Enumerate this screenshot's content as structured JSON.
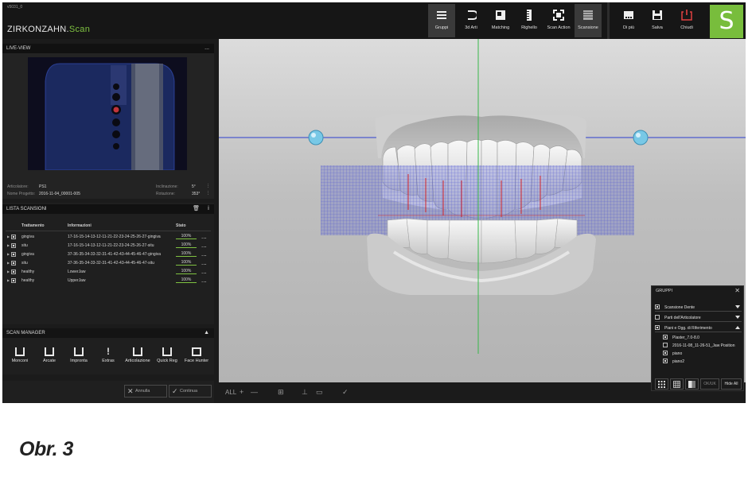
{
  "version": "v5031_0",
  "brand": {
    "name": "ZIRKONZAHN.",
    "suffix": "Scan"
  },
  "toolbar": {
    "gruppi": "Gruppi",
    "arti3d": "3d Arti",
    "matching": "Matching",
    "righello": "Righello",
    "scan_action": "Scan Action",
    "scansione": "Scansione",
    "di_piu": "Di più",
    "salva": "Salva",
    "chiudi": "Chiudi",
    "logo": "S"
  },
  "live_view": {
    "title": "LIVE-VIEW",
    "more": "...",
    "articolatore_label": "Articolatore:",
    "articolatore_value": "PS1",
    "nome_label": "Nome Progetto:",
    "nome_value": "2016-11-04_00001-005",
    "inclinazione_label": "Inclinazione:",
    "inclinazione_value": "5°",
    "rotazione_label": "Rotazione:",
    "rotazione_value": "353°"
  },
  "scan_list": {
    "title": "LISTA SCANSIONI",
    "headers": {
      "trattamento": "Trattamento",
      "informazioni": "Informazioni",
      "stato": "Stato"
    },
    "rows": [
      {
        "trattamento": "gingiva",
        "info": "17-16-15-14-13-12-11-21-22-23-24-25-26-27-gingiva",
        "stato": "100%"
      },
      {
        "trattamento": "situ",
        "info": "17-16-15-14-13-12-11-21-22-23-24-25-26-27-situ",
        "stato": "100%"
      },
      {
        "trattamento": "gingiva",
        "info": "37-36-35-34-33-32-31-41-42-43-44-45-46-47-gingiva",
        "stato": "100%"
      },
      {
        "trattamento": "situ",
        "info": "37-36-35-34-33-32-31-41-42-43-44-45-46-47-situ",
        "stato": "100%"
      },
      {
        "trattamento": "healthy",
        "info": "LowerJaw",
        "stato": "100%"
      },
      {
        "trattamento": "healthy",
        "info": "UpperJaw",
        "stato": "100%"
      }
    ],
    "more": "..."
  },
  "scan_manager": {
    "title": "SCAN MANAGER",
    "buttons": [
      "Monconi",
      "Arcate",
      "Impronta",
      "Extras",
      "Articolazione",
      "Quick Reg",
      "Face Hunter"
    ]
  },
  "actions": {
    "annulla": "Annulla",
    "continua": "Continua"
  },
  "viewport_toolbar": {
    "all": "ALL",
    "plus": "+",
    "minus": "—"
  },
  "gruppi_panel": {
    "title": "GRUPPI",
    "close": "✕",
    "groups": [
      {
        "label": "Scansione Dente",
        "checked": true
      },
      {
        "label": "Parti dell'Articolatore",
        "checked": false
      },
      {
        "label": "Piani e Ogg. di Riferimento",
        "checked": true
      }
    ],
    "subitems": [
      {
        "label": "Plaster_7.0-8.0",
        "checked": true
      },
      {
        "label": "2016-11-08_11-26-51_Jaw Position",
        "checked": false
      },
      {
        "label": "piano",
        "checked": true
      },
      {
        "label": "piano2",
        "checked": true
      }
    ],
    "buttons": {
      "ok": "OK/UK",
      "hide_all": "Hide All"
    }
  },
  "caption": "Obr. 3"
}
